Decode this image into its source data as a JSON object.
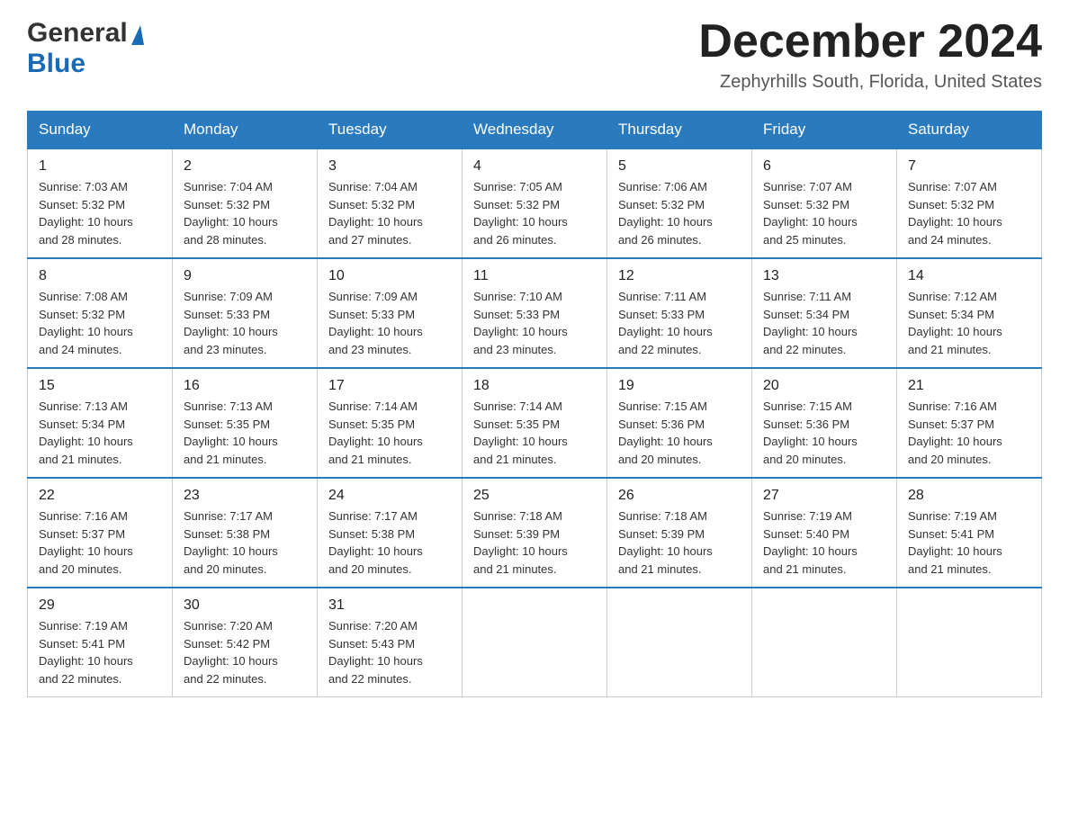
{
  "logo": {
    "general": "General",
    "blue": "Blue"
  },
  "title": {
    "month_year": "December 2024",
    "location": "Zephyrhills South, Florida, United States"
  },
  "headers": [
    "Sunday",
    "Monday",
    "Tuesday",
    "Wednesday",
    "Thursday",
    "Friday",
    "Saturday"
  ],
  "weeks": [
    [
      {
        "day": "1",
        "sunrise": "7:03 AM",
        "sunset": "5:32 PM",
        "daylight": "10 hours and 28 minutes."
      },
      {
        "day": "2",
        "sunrise": "7:04 AM",
        "sunset": "5:32 PM",
        "daylight": "10 hours and 28 minutes."
      },
      {
        "day": "3",
        "sunrise": "7:04 AM",
        "sunset": "5:32 PM",
        "daylight": "10 hours and 27 minutes."
      },
      {
        "day": "4",
        "sunrise": "7:05 AM",
        "sunset": "5:32 PM",
        "daylight": "10 hours and 26 minutes."
      },
      {
        "day": "5",
        "sunrise": "7:06 AM",
        "sunset": "5:32 PM",
        "daylight": "10 hours and 26 minutes."
      },
      {
        "day": "6",
        "sunrise": "7:07 AM",
        "sunset": "5:32 PM",
        "daylight": "10 hours and 25 minutes."
      },
      {
        "day": "7",
        "sunrise": "7:07 AM",
        "sunset": "5:32 PM",
        "daylight": "10 hours and 24 minutes."
      }
    ],
    [
      {
        "day": "8",
        "sunrise": "7:08 AM",
        "sunset": "5:32 PM",
        "daylight": "10 hours and 24 minutes."
      },
      {
        "day": "9",
        "sunrise": "7:09 AM",
        "sunset": "5:33 PM",
        "daylight": "10 hours and 23 minutes."
      },
      {
        "day": "10",
        "sunrise": "7:09 AM",
        "sunset": "5:33 PM",
        "daylight": "10 hours and 23 minutes."
      },
      {
        "day": "11",
        "sunrise": "7:10 AM",
        "sunset": "5:33 PM",
        "daylight": "10 hours and 23 minutes."
      },
      {
        "day": "12",
        "sunrise": "7:11 AM",
        "sunset": "5:33 PM",
        "daylight": "10 hours and 22 minutes."
      },
      {
        "day": "13",
        "sunrise": "7:11 AM",
        "sunset": "5:34 PM",
        "daylight": "10 hours and 22 minutes."
      },
      {
        "day": "14",
        "sunrise": "7:12 AM",
        "sunset": "5:34 PM",
        "daylight": "10 hours and 21 minutes."
      }
    ],
    [
      {
        "day": "15",
        "sunrise": "7:13 AM",
        "sunset": "5:34 PM",
        "daylight": "10 hours and 21 minutes."
      },
      {
        "day": "16",
        "sunrise": "7:13 AM",
        "sunset": "5:35 PM",
        "daylight": "10 hours and 21 minutes."
      },
      {
        "day": "17",
        "sunrise": "7:14 AM",
        "sunset": "5:35 PM",
        "daylight": "10 hours and 21 minutes."
      },
      {
        "day": "18",
        "sunrise": "7:14 AM",
        "sunset": "5:35 PM",
        "daylight": "10 hours and 21 minutes."
      },
      {
        "day": "19",
        "sunrise": "7:15 AM",
        "sunset": "5:36 PM",
        "daylight": "10 hours and 20 minutes."
      },
      {
        "day": "20",
        "sunrise": "7:15 AM",
        "sunset": "5:36 PM",
        "daylight": "10 hours and 20 minutes."
      },
      {
        "day": "21",
        "sunrise": "7:16 AM",
        "sunset": "5:37 PM",
        "daylight": "10 hours and 20 minutes."
      }
    ],
    [
      {
        "day": "22",
        "sunrise": "7:16 AM",
        "sunset": "5:37 PM",
        "daylight": "10 hours and 20 minutes."
      },
      {
        "day": "23",
        "sunrise": "7:17 AM",
        "sunset": "5:38 PM",
        "daylight": "10 hours and 20 minutes."
      },
      {
        "day": "24",
        "sunrise": "7:17 AM",
        "sunset": "5:38 PM",
        "daylight": "10 hours and 20 minutes."
      },
      {
        "day": "25",
        "sunrise": "7:18 AM",
        "sunset": "5:39 PM",
        "daylight": "10 hours and 21 minutes."
      },
      {
        "day": "26",
        "sunrise": "7:18 AM",
        "sunset": "5:39 PM",
        "daylight": "10 hours and 21 minutes."
      },
      {
        "day": "27",
        "sunrise": "7:19 AM",
        "sunset": "5:40 PM",
        "daylight": "10 hours and 21 minutes."
      },
      {
        "day": "28",
        "sunrise": "7:19 AM",
        "sunset": "5:41 PM",
        "daylight": "10 hours and 21 minutes."
      }
    ],
    [
      {
        "day": "29",
        "sunrise": "7:19 AM",
        "sunset": "5:41 PM",
        "daylight": "10 hours and 22 minutes."
      },
      {
        "day": "30",
        "sunrise": "7:20 AM",
        "sunset": "5:42 PM",
        "daylight": "10 hours and 22 minutes."
      },
      {
        "day": "31",
        "sunrise": "7:20 AM",
        "sunset": "5:43 PM",
        "daylight": "10 hours and 22 minutes."
      },
      null,
      null,
      null,
      null
    ]
  ],
  "labels": {
    "sunrise": "Sunrise:",
    "sunset": "Sunset:",
    "daylight": "Daylight:"
  }
}
